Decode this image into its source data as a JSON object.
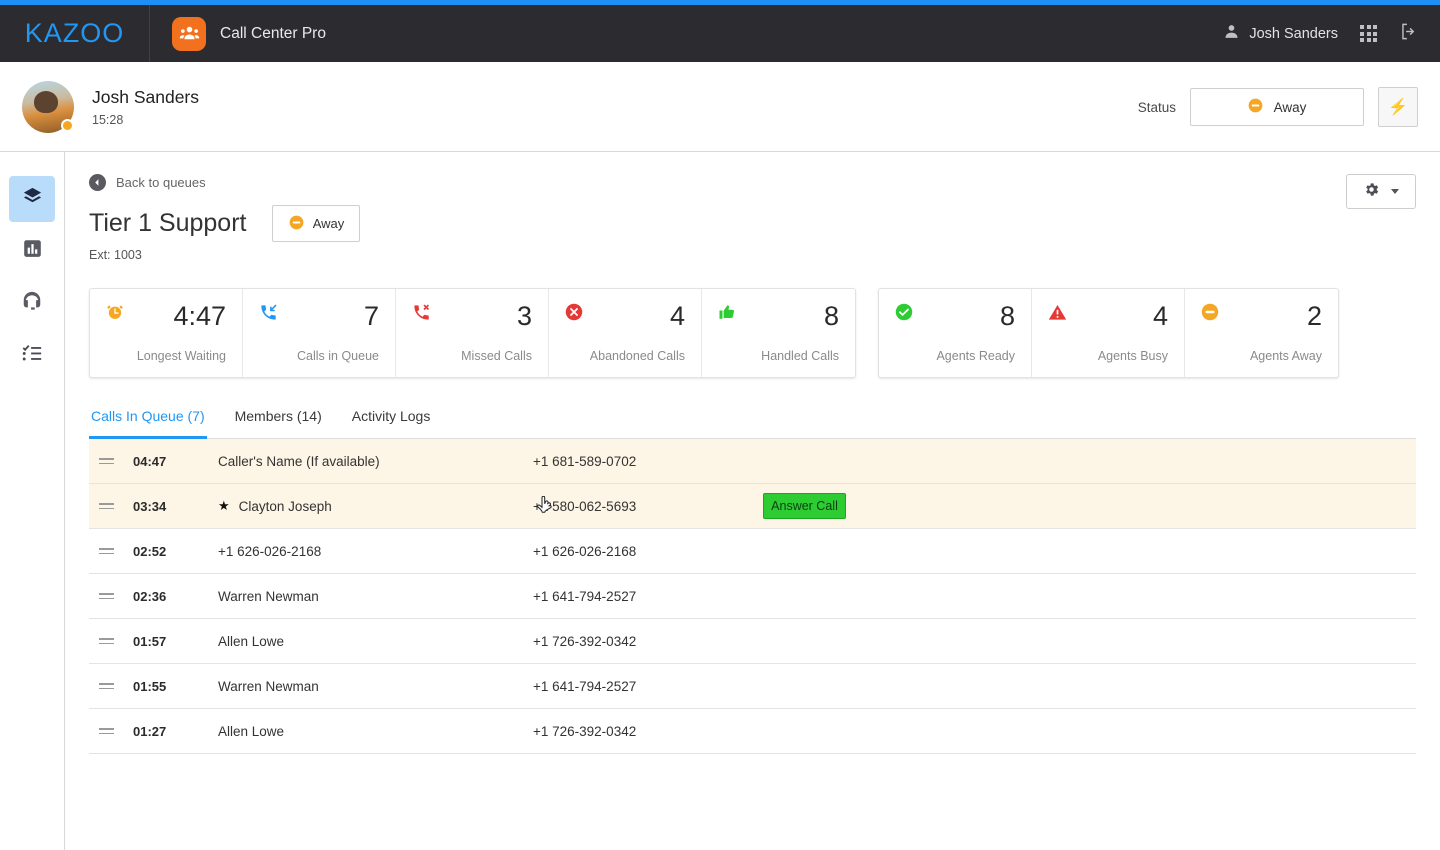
{
  "header": {
    "brand": "KAZOO",
    "app_name": "Call Center Pro",
    "app_icon": "agents-headset-icon",
    "user_name": "Josh Sanders",
    "user_icon": "user-icon",
    "apps_icon": "apps-grid-icon",
    "logout_icon": "logout-icon",
    "accent_color": "#1e90f5",
    "bar_color": "#2b2b30"
  },
  "profile": {
    "name": "Josh Sanders",
    "time": "15:28",
    "status_label": "Status",
    "status_value": "Away",
    "status_icon": "minus-circle-icon",
    "status_color": "#f5a623",
    "bolt_icon": "⚡"
  },
  "sidebar": {
    "items": [
      {
        "name": "sidebar-item-queues",
        "icon": "layers-icon",
        "active": true
      },
      {
        "name": "sidebar-item-reports",
        "icon": "bar-chart-icon",
        "active": false
      },
      {
        "name": "sidebar-item-agents",
        "icon": "headset-icon",
        "active": false
      },
      {
        "name": "sidebar-item-logs",
        "icon": "checklist-icon",
        "active": false
      }
    ],
    "active_bg": "#b9dcfb"
  },
  "queue": {
    "back_label": "Back to queues",
    "back_icon": "arrow-left-circle-icon",
    "title": "Tier 1 Support",
    "badge_status": "Away",
    "badge_icon": "minus-circle-icon",
    "extension": "Ext: 1003",
    "gear_icon": "gear-icon",
    "caret_icon": "chevron-down-icon"
  },
  "stats": {
    "group_one": [
      {
        "name": "stat-longest-waiting",
        "icon": "alarm-clock-icon",
        "color": "#f5a623",
        "value": "4:47",
        "label": "Longest Waiting"
      },
      {
        "name": "stat-calls-in-queue",
        "icon": "incoming-call-icon",
        "color": "#2196f3",
        "value": "7",
        "label": "Calls in Queue"
      },
      {
        "name": "stat-missed-calls",
        "icon": "missed-call-icon",
        "color": "#e53935",
        "value": "3",
        "label": "Missed Calls"
      },
      {
        "name": "stat-abandoned-calls",
        "icon": "x-circle-icon",
        "color": "#e53935",
        "value": "4",
        "label": "Abandoned Calls"
      },
      {
        "name": "stat-handled-calls",
        "icon": "thumbs-up-icon",
        "color": "#2ecc33",
        "value": "8",
        "label": "Handled Calls"
      }
    ],
    "group_two": [
      {
        "name": "stat-agents-ready",
        "icon": "check-circle-icon",
        "color": "#2ecc33",
        "value": "8",
        "label": "Agents Ready"
      },
      {
        "name": "stat-agents-busy",
        "icon": "warning-triangle-icon",
        "color": "#e53935",
        "value": "4",
        "label": "Agents Busy"
      },
      {
        "name": "stat-agents-away",
        "icon": "minus-circle-icon",
        "color": "#f5a623",
        "value": "2",
        "label": "Agents Away"
      }
    ]
  },
  "tabs": [
    {
      "name": "tab-calls-in-queue",
      "label": "Calls In Queue (7)",
      "active": true
    },
    {
      "name": "tab-members",
      "label": "Members (14)",
      "active": false
    },
    {
      "name": "tab-activity-logs",
      "label": "Activity Logs",
      "active": false
    }
  ],
  "calls": [
    {
      "timer": "04:47",
      "caller": "Caller's Name (If available)",
      "phone": "+1 681-589-0702",
      "starred": false,
      "highlight": true,
      "action": ""
    },
    {
      "timer": "03:34",
      "caller": "Clayton Joseph",
      "phone": "+1 580-062-5693",
      "starred": true,
      "highlight": true,
      "action": "Answer Call"
    },
    {
      "timer": "02:52",
      "caller": "+1 626-026-2168",
      "phone": "+1 626-026-2168",
      "starred": false,
      "highlight": false,
      "action": ""
    },
    {
      "timer": "02:36",
      "caller": "Warren Newman",
      "phone": "+1 641-794-2527",
      "starred": false,
      "highlight": false,
      "action": ""
    },
    {
      "timer": "01:57",
      "caller": "Allen Lowe",
      "phone": "+1 726-392-0342",
      "starred": false,
      "highlight": false,
      "action": ""
    },
    {
      "timer": "01:55",
      "caller": "Warren Newman",
      "phone": "+1 641-794-2527",
      "starred": false,
      "highlight": false,
      "action": ""
    },
    {
      "timer": "01:27",
      "caller": "Allen Lowe",
      "phone": "+1 726-392-0342",
      "starred": false,
      "highlight": false,
      "action": ""
    }
  ]
}
